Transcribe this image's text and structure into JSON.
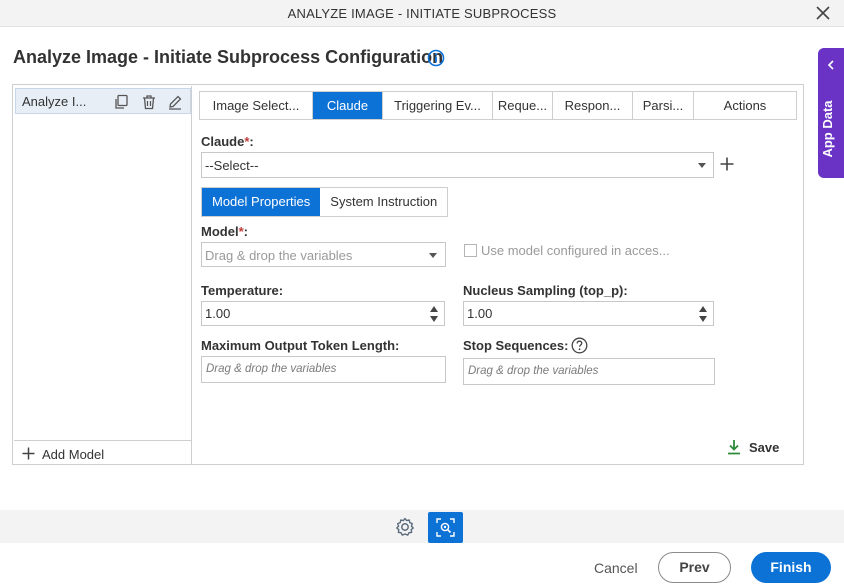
{
  "window": {
    "title": "ANALYZE IMAGE - INITIATE SUBPROCESS",
    "close_icon": "close-icon"
  },
  "page": {
    "heading": "Analyze Image - Initiate Subprocess Configuration",
    "info_icon": "info-icon"
  },
  "side_tab": {
    "label": "App Data"
  },
  "models_panel": {
    "selected_item": "Analyze I...",
    "add_label": "Add Model"
  },
  "tabs": [
    {
      "label": "Image Select...",
      "active": false
    },
    {
      "label": "Claude",
      "active": true
    },
    {
      "label": "Triggering Ev...",
      "active": false
    },
    {
      "label": "Reque...",
      "active": false
    },
    {
      "label": "Respon...",
      "active": false
    },
    {
      "label": "Parsi...",
      "active": false
    },
    {
      "label": "Actions",
      "active": false
    }
  ],
  "claude": {
    "label": "Claude",
    "required_mark": "*",
    "colon": ":",
    "value": "--Select--"
  },
  "subtabs": [
    {
      "label": "Model Properties",
      "active": true
    },
    {
      "label": "System Instruction",
      "active": false
    }
  ],
  "model": {
    "label": "Model",
    "required_mark": "*",
    "colon": ":",
    "placeholder": "Drag & drop the variables",
    "checkbox_label": "Use model configured in acces...",
    "checkbox_checked": false
  },
  "temperature": {
    "label": "Temperature:",
    "value": "1.00"
  },
  "nucleus": {
    "label": "Nucleus Sampling (top_p):",
    "value": "1.00"
  },
  "max_tokens": {
    "label": "Maximum Output Token Length:",
    "placeholder": "Drag & drop the variables"
  },
  "stop_sequences": {
    "label": "Stop Sequences:",
    "placeholder": "Drag & drop the variables"
  },
  "save_label": "Save",
  "footer": {
    "cancel_label": "Cancel",
    "prev_label": "Prev",
    "finish_label": "Finish"
  },
  "colors": {
    "accent": "#0d72d6",
    "side_tab": "#6a33c6",
    "save_icon": "#2e8b3a"
  }
}
